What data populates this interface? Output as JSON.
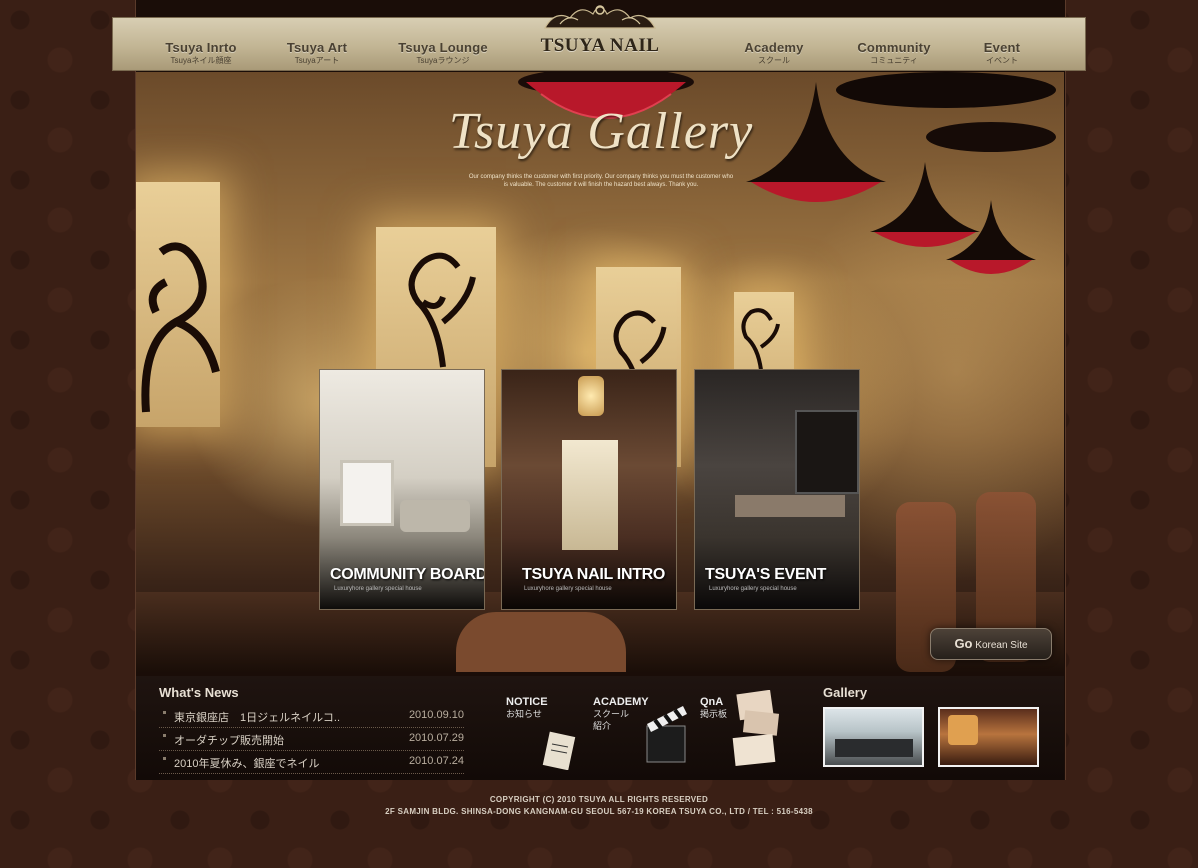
{
  "brand": {
    "name": "TSUYA NAIL"
  },
  "nav": [
    {
      "main": "Tsuya Inrto",
      "sub": "Tsuyaネイル顔座"
    },
    {
      "main": "Tsuya Art",
      "sub": "Tsuyaアート"
    },
    {
      "main": "Tsuya Lounge",
      "sub": "Tsuyaラウンジ"
    },
    {
      "main": "Academy",
      "sub": "スクール"
    },
    {
      "main": "Community",
      "sub": "コミュニティ"
    },
    {
      "main": "Event",
      "sub": "イベント"
    }
  ],
  "hero": {
    "title": "Tsuya Gallery",
    "tagline": "Our company thinks the customer with first priority. Our company thinks you must the customer who is valuable. The customer it will finish the hazard best always. Thank you."
  },
  "cards": [
    {
      "label": "COMMUNITY BOARD",
      "sub": "Luxuryhore gallery special house"
    },
    {
      "label": "TSUYA NAIL INTRO",
      "sub": "Luxuryhore gallery special house"
    },
    {
      "label": "TSUYA'S EVENT",
      "sub": "Luxuryhore gallery special house"
    }
  ],
  "go_korean": {
    "prefix": "Go",
    "label": "Korean Site"
  },
  "news": {
    "title": "What's News",
    "items": [
      {
        "text": "東京銀座店　1日ジェルネイルコ..",
        "date": "2010.09.10"
      },
      {
        "text": "オーダチップ販売開始",
        "date": "2010.07.29"
      },
      {
        "text": "2010年夏休み、銀座でネイル",
        "date": "2010.07.24"
      }
    ]
  },
  "quick_links": {
    "notice": {
      "title": "NOTICE",
      "sub": "お知らせ"
    },
    "academy": {
      "title": "ACADEMY",
      "sub1": "スクール",
      "sub2": "紹介"
    },
    "qna": {
      "title": "QnA",
      "sub": "掲示板"
    }
  },
  "gallery": {
    "title": "Gallery"
  },
  "footer": {
    "line1": "COPYRIGHT (C) 2010 TSUYA  ALL RIGHTS RESERVED",
    "line2": "2F SAMJIN BLDG. SHINSA-DONG KANGNAM-GU SEOUL 567-19 KOREA TSUYA CO., LTD / TEL : 516-5438"
  },
  "colors": {
    "nav_gold": "#c2b594",
    "page_bg": "#3a1f15",
    "lamp_red": "#b8182a"
  }
}
